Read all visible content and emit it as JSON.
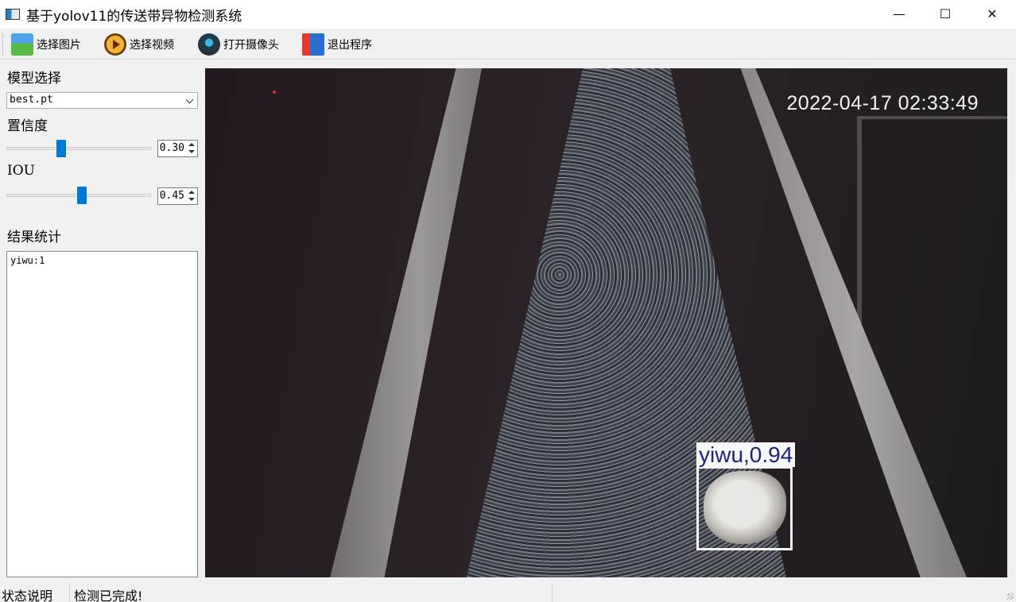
{
  "window": {
    "title": "基于yolov11的传送带异物检测系统",
    "min_glyph": "—",
    "max_glyph": "☐",
    "close_glyph": "✕"
  },
  "toolbar": {
    "select_image": "选择图片",
    "select_video": "选择视频",
    "open_camera": "打开摄像头",
    "exit_program": "退出程序"
  },
  "panel": {
    "model_label": "模型选择",
    "model_value": "best.pt",
    "conf_label": "置信度",
    "conf_value": "0.30",
    "conf_level": 0.3,
    "iou_label": "IOU",
    "iou_value": "0.45",
    "iou_level": 0.45,
    "results_label": "结果统计",
    "results_text": "yiwu:1"
  },
  "view": {
    "timestamp": "2022-04-17 02:33:49",
    "detection_label": "yiwu,0.94"
  },
  "status": {
    "label": "状态说明",
    "value": "检测已完成!"
  }
}
